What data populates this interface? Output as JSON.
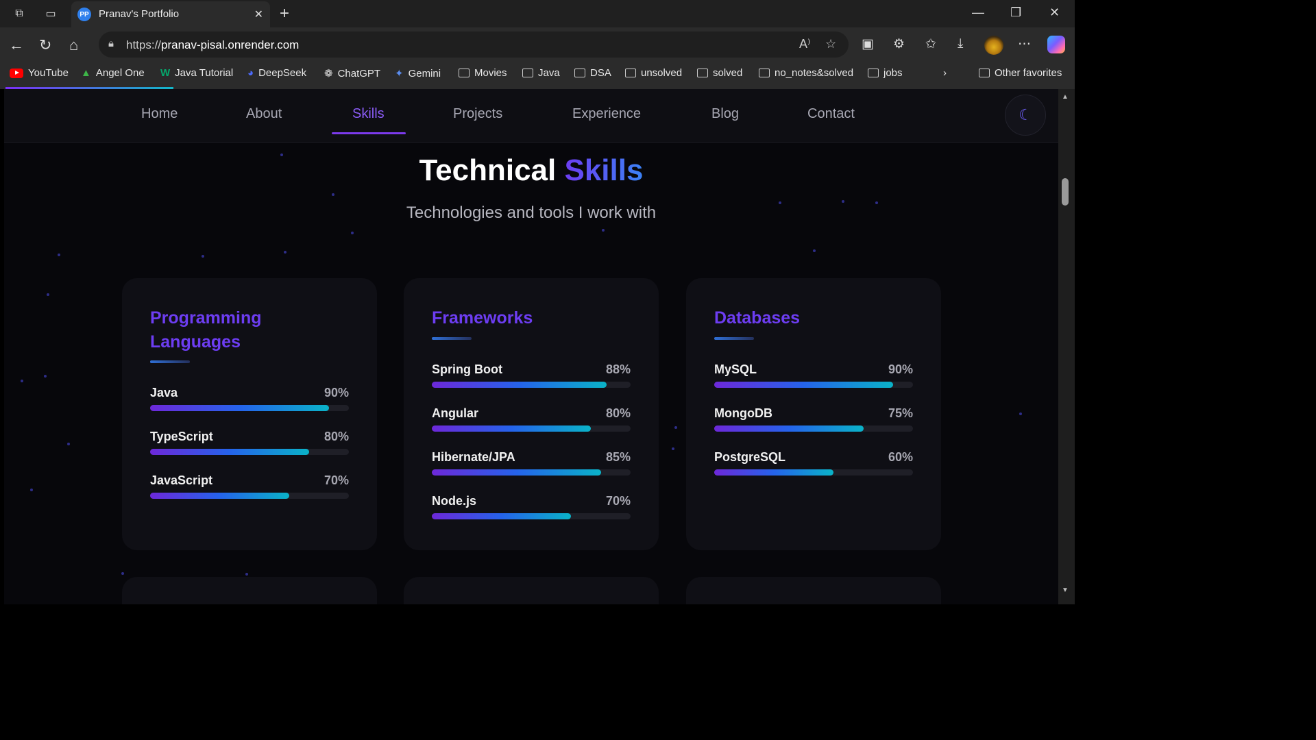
{
  "browser": {
    "tab_title": "Pranav's Portfolio",
    "tab_favicon": "PP",
    "url_prefix": "https://",
    "url_domain": "pranav-pisal.onrender.com",
    "bookmarks": [
      "YouTube",
      "Angel One",
      "Java Tutorial",
      "DeepSeek",
      "ChatGPT",
      "Gemini",
      "Movies",
      "Java",
      "DSA",
      "unsolved",
      "solved",
      "no_notes&solved",
      "jobs"
    ],
    "other_favorites": "Other favorites"
  },
  "nav": {
    "items": [
      "Home",
      "About",
      "Skills",
      "Projects",
      "Experience",
      "Blog",
      "Contact"
    ],
    "active": "Skills"
  },
  "hero": {
    "title_main": "Technical",
    "title_accent": "Skills",
    "subtitle": "Technologies and tools I work with"
  },
  "cards": [
    {
      "title": "Programming Languages",
      "skills": [
        {
          "name": "Java",
          "percent_label": "90%",
          "level": 90
        },
        {
          "name": "TypeScript",
          "percent_label": "80%",
          "level": 80
        },
        {
          "name": "JavaScript",
          "percent_label": "70%",
          "level": 70
        }
      ]
    },
    {
      "title": "Frameworks",
      "skills": [
        {
          "name": "Spring Boot",
          "percent_label": "88%",
          "level": 88
        },
        {
          "name": "Angular",
          "percent_label": "80%",
          "level": 80
        },
        {
          "name": "Hibernate/JPA",
          "percent_label": "85%",
          "level": 85
        },
        {
          "name": "Node.js",
          "percent_label": "70%",
          "level": 70
        }
      ]
    },
    {
      "title": "Databases",
      "skills": [
        {
          "name": "MySQL",
          "percent_label": "90%",
          "level": 90
        },
        {
          "name": "MongoDB",
          "percent_label": "75%",
          "level": 75
        },
        {
          "name": "PostgreSQL",
          "percent_label": "60%",
          "level": 60
        }
      ]
    }
  ],
  "colors": {
    "accent": "#6d3df2",
    "page_bg": "#07070b",
    "card_bg": "#0f0f15"
  }
}
